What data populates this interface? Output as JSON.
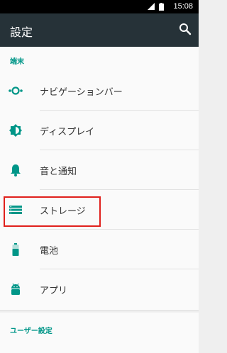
{
  "status_bar": {
    "time": "15:08"
  },
  "toolbar": {
    "title": "設定"
  },
  "sections": {
    "terminal": "端末",
    "user": "ユーザー設定"
  },
  "items": [
    {
      "label": "ナビゲーションバー",
      "icon": "navigation-bar-icon"
    },
    {
      "label": "ディスプレイ",
      "icon": "display-brightness-icon"
    },
    {
      "label": "音と通知",
      "icon": "bell-icon"
    },
    {
      "label": "ストレージ",
      "icon": "storage-icon"
    },
    {
      "label": "電池",
      "icon": "battery-icon"
    },
    {
      "label": "アプリ",
      "icon": "android-icon"
    }
  ],
  "colors": {
    "accent": "#009688",
    "toolbar": "#263238",
    "highlight": "#e0201c"
  }
}
